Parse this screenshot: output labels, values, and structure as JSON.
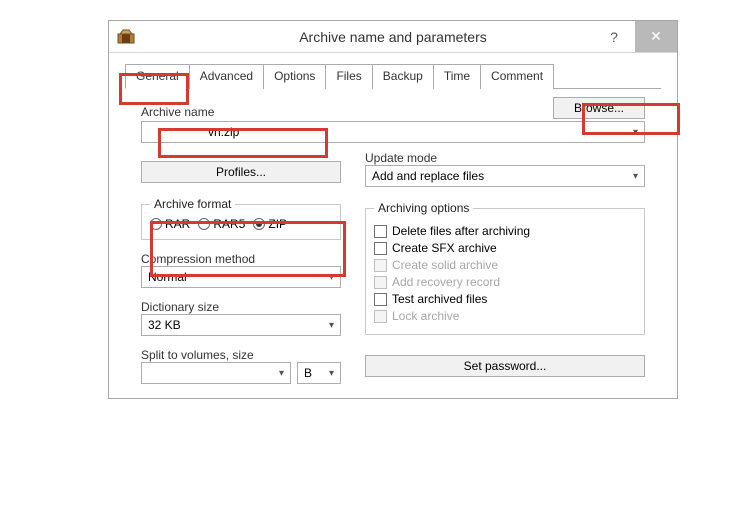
{
  "window": {
    "title": "Archive name and parameters",
    "help_symbol": "?",
    "close_symbol": "✕"
  },
  "tabs": [
    {
      "label": "General",
      "active": true
    },
    {
      "label": "Advanced"
    },
    {
      "label": "Options"
    },
    {
      "label": "Files"
    },
    {
      "label": "Backup"
    },
    {
      "label": "Time"
    },
    {
      "label": "Comment"
    }
  ],
  "archive_name": {
    "label": "Archive name",
    "value": "vn.zip",
    "browse": "Browse..."
  },
  "profiles_btn": "Profiles...",
  "update_mode": {
    "label": "Update mode",
    "value": "Add and replace files"
  },
  "archive_format": {
    "legend": "Archive format",
    "options": [
      {
        "label": "RAR",
        "checked": false
      },
      {
        "label": "RAR5",
        "checked": false
      },
      {
        "label": "ZIP",
        "checked": true
      }
    ]
  },
  "compression_method": {
    "label": "Compression method",
    "value": "Normal"
  },
  "dictionary_size": {
    "label": "Dictionary size",
    "value": "32 KB"
  },
  "split_volumes": {
    "label": "Split to volumes, size",
    "value": "",
    "unit": "B"
  },
  "archiving_options": {
    "legend": "Archiving options",
    "items": [
      {
        "label": "Delete files after archiving",
        "disabled": false
      },
      {
        "label": "Create SFX archive",
        "disabled": false
      },
      {
        "label": "Create solid archive",
        "disabled": true
      },
      {
        "label": "Add recovery record",
        "disabled": true
      },
      {
        "label": "Test archived files",
        "disabled": false
      },
      {
        "label": "Lock archive",
        "disabled": true
      }
    ]
  },
  "set_password_btn": "Set password..."
}
